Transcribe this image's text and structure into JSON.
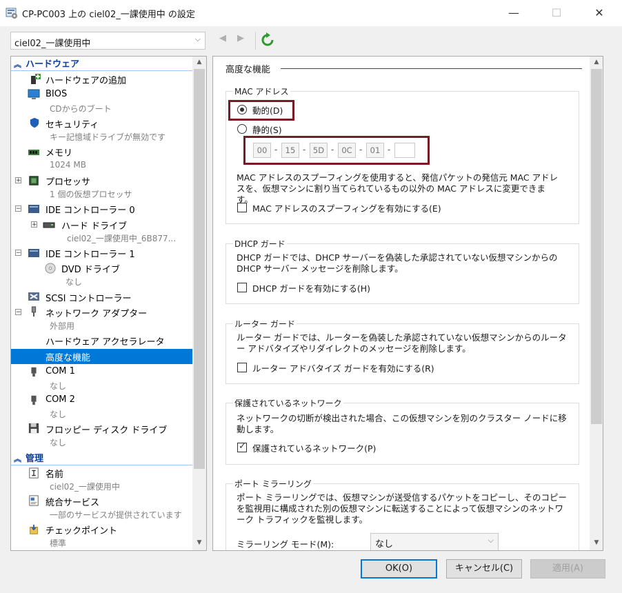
{
  "window": {
    "title": "CP-PC003 上の ciel02_一課使用中 の設定",
    "minimize": "—",
    "maximize": "☐",
    "close": "✕"
  },
  "toolbar": {
    "vm_selector_value": "ciel02_一課使用中",
    "back": "◀",
    "forward": "▶"
  },
  "tree": {
    "hardware_header": "ハードウェア",
    "items": [
      {
        "label": "ハードウェアの追加",
        "sub": ""
      },
      {
        "label": "BIOS",
        "sub": "CDからのブート"
      },
      {
        "label": "セキュリティ",
        "sub": "キー記憶域ドライブが無効です"
      },
      {
        "label": "メモリ",
        "sub": "1024 MB"
      },
      {
        "label": "プロセッサ",
        "sub": "1 個の仮想プロセッサ"
      },
      {
        "label": "IDE コントローラー 0",
        "sub": ""
      },
      {
        "label": "ハード ドライブ",
        "sub": "ciel02_一課使用中_6B877..."
      },
      {
        "label": "IDE コントローラー 1",
        "sub": ""
      },
      {
        "label": "DVD ドライブ",
        "sub": "なし"
      },
      {
        "label": "SCSI コントローラー",
        "sub": ""
      },
      {
        "label": "ネットワーク アダプター",
        "sub": "外部用"
      },
      {
        "label": "ハードウェア アクセラレータ",
        "sub": ""
      },
      {
        "label": "高度な機能",
        "sub": ""
      },
      {
        "label": "COM 1",
        "sub": "なし"
      },
      {
        "label": "COM 2",
        "sub": "なし"
      },
      {
        "label": "フロッピー ディスク ドライブ",
        "sub": "なし"
      }
    ],
    "management_header": "管理",
    "mgmt_items": [
      {
        "label": "名前",
        "sub": "ciel02_一課使用中"
      },
      {
        "label": "統合サービス",
        "sub": "一部のサービスが提供されています"
      },
      {
        "label": "チェックポイント",
        "sub": "標準"
      }
    ]
  },
  "panel": {
    "title": "高度な機能",
    "mac": {
      "group_title": "MAC アドレス",
      "dynamic_label": "動的(D)",
      "static_label": "静的(S)",
      "selected": "dynamic",
      "segments": [
        "00",
        "15",
        "5D",
        "0C",
        "01",
        ""
      ],
      "description": "MAC アドレスのスプーフィングを使用すると、発信パケットの発信元 MAC アドレスを、仮想マシンに割り当てられているもの以外の MAC アドレスに変更できます。",
      "spoof_label": "MAC アドレスのスプーフィングを有効にする(E)",
      "spoof_checked": false
    },
    "dhcp": {
      "group_title": "DHCP ガード",
      "description": "DHCP ガードでは、DHCP サーバーを偽装した承認されていない仮想マシンからの DHCP サーバー メッセージを削除します。",
      "label": "DHCP ガードを有効にする(H)",
      "checked": false
    },
    "router": {
      "group_title": "ルーター ガード",
      "description": "ルーター ガードでは、ルーターを偽装した承認されていない仮想マシンからのルーター アドバタイズやリダイレクトのメッセージを削除します。",
      "label": "ルーター アドバタイズ ガードを有効にする(R)",
      "checked": false
    },
    "protected": {
      "group_title": "保護されているネットワーク",
      "description": "ネットワークの切断が検出された場合、この仮想マシンを別のクラスター ノードに移動します。",
      "label": "保護されているネットワーク(P)",
      "checked": true
    },
    "mirror": {
      "group_title": "ポート ミラーリング",
      "description": "ポート ミラーリングでは、仮想マシンが送受信するパケットをコピーし、そのコピーを監視用に構成された別の仮想マシンに転送することによって仮想マシンのネットワーク トラフィックを監視します。",
      "mode_label": "ミラーリング モード(M):",
      "mode_value": "なし"
    }
  },
  "buttons": {
    "ok": "OK(O)",
    "cancel": "キャンセル(C)",
    "apply": "適用(A)"
  },
  "colors": {
    "accent": "#0078d7",
    "highlight_box": "#7a1a25",
    "header_text": "#0a3ea0"
  }
}
